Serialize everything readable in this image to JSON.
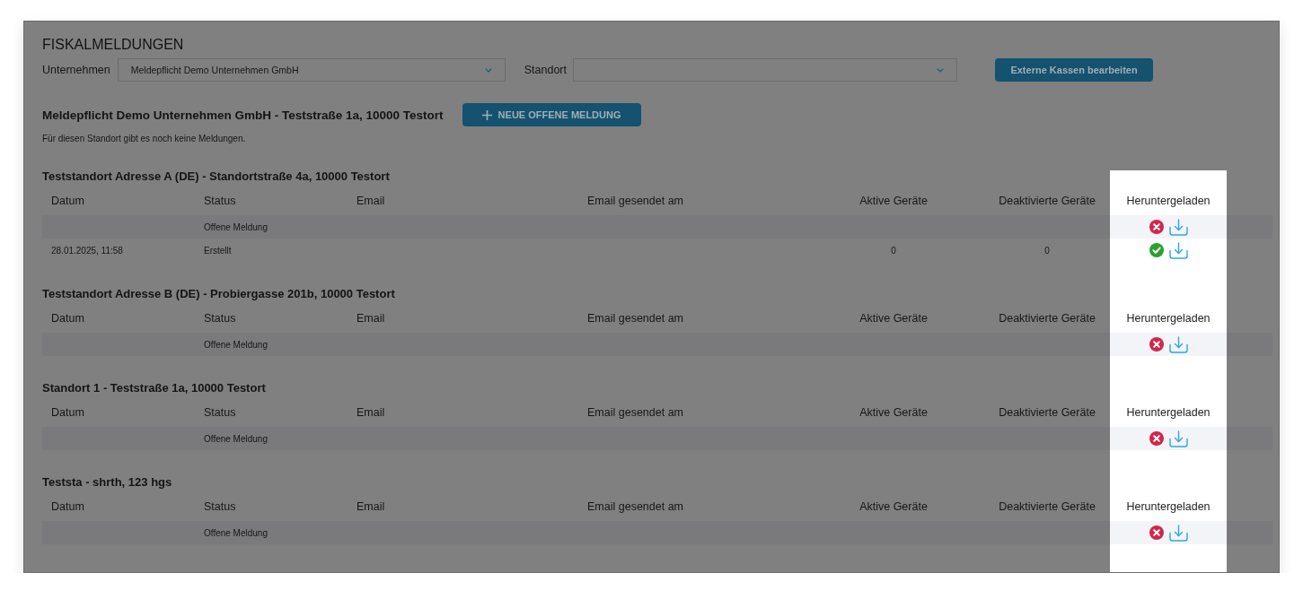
{
  "page": {
    "title": "FISKALMELDUNGEN"
  },
  "filters": {
    "company": {
      "label": "Unternehmen",
      "value": "Meldepflicht Demo Unternehmen GmbH"
    },
    "location": {
      "label": "Standort"
    },
    "edit_button": "Externe Kassen bearbeiten"
  },
  "company": {
    "heading": "Meldepflicht Demo Unternehmen GmbH - Teststraße 1a, 10000 Testort",
    "new_button": "NEUE OFFENE MELDUNG",
    "note": "Für diesen Standort gibt es noch keine Meldungen."
  },
  "locations": [
    {
      "title": "Teststandort Adresse A (DE) - Standortstraße 4a, 10000 Testort",
      "columns": [
        {
          "label": "Datum",
          "highlighted": false
        },
        {
          "label": "Status",
          "highlighted": false
        },
        {
          "label": "Email",
          "highlighted": false
        },
        {
          "label": "Email gesendet am",
          "highlighted": false
        },
        {
          "label": "Aktive Geräte",
          "highlighted": false
        },
        {
          "label": "Deaktivierte Geräte",
          "highlighted": false
        },
        {
          "label": "Heruntergeladen",
          "highlighted": true
        }
      ],
      "rows": [
        {
          "status": "Offene Meldung",
          "downloaded": false
        },
        {
          "date": "28.01.2025, 11:58",
          "status": "Erstellt",
          "active_devices": "0",
          "deactivated_devices": "0",
          "downloaded": true
        }
      ]
    },
    {
      "title": "Teststandort Adresse B (DE) - Probiergasse 201b, 10000 Testort",
      "columns": [
        {
          "label": "Datum",
          "highlighted": false
        },
        {
          "label": "Status",
          "highlighted": false
        },
        {
          "label": "Email",
          "highlighted": false
        },
        {
          "label": "Email gesendet am",
          "highlighted": false
        },
        {
          "label": "Aktive Geräte",
          "highlighted": false
        },
        {
          "label": "Deaktivierte Geräte",
          "highlighted": false
        },
        {
          "label": "Heruntergeladen",
          "highlighted": true
        }
      ],
      "rows": [
        {
          "status": "Offene Meldung",
          "downloaded": false
        }
      ]
    },
    {
      "title": "Standort 1 - Teststraße 1a, 10000 Testort",
      "columns": [
        {
          "label": "Datum",
          "highlighted": false
        },
        {
          "label": "Status",
          "highlighted": false
        },
        {
          "label": "Email",
          "highlighted": false
        },
        {
          "label": "Email gesendet am",
          "highlighted": false
        },
        {
          "label": "Aktive Geräte",
          "highlighted": false
        },
        {
          "label": "Deaktivierte Geräte",
          "highlighted": false
        },
        {
          "label": "Heruntergeladen",
          "highlighted": true
        }
      ],
      "rows": [
        {
          "status": "Offene Meldung",
          "downloaded": false
        }
      ]
    },
    {
      "title": "Teststa - shrth, 123 hgs",
      "columns": [
        {
          "label": "Datum",
          "highlighted": false
        },
        {
          "label": "Status",
          "highlighted": false
        },
        {
          "label": "Email",
          "highlighted": false
        },
        {
          "label": "Email gesendet am",
          "highlighted": false
        },
        {
          "label": "Aktive Geräte",
          "highlighted": false
        },
        {
          "label": "Deaktivierte Geräte",
          "highlighted": false
        },
        {
          "label": "Heruntergeladen",
          "highlighted": true
        }
      ],
      "rows": [
        {
          "status": "Offene Meldung",
          "downloaded": false
        }
      ]
    }
  ]
}
